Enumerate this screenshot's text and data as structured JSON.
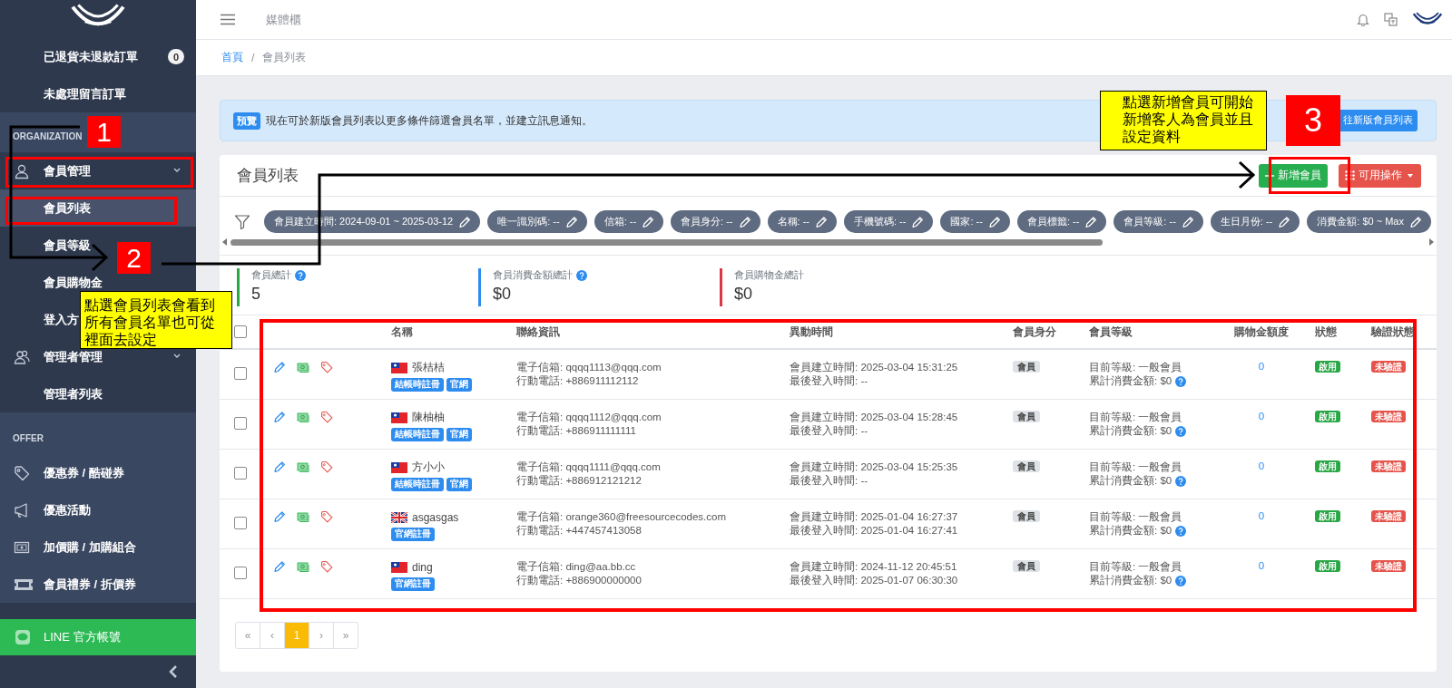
{
  "sidebar": {
    "sections": [
      {
        "items": [
          {
            "label": "已退貨未退款訂單",
            "badge": "0",
            "selected": false
          },
          {
            "label": "未處理留言訂單",
            "selected": false
          }
        ]
      },
      {
        "title": "ORGANIZATION",
        "items": [
          {
            "label": "會員管理",
            "expanded": true,
            "selected": false,
            "children": [
              {
                "label": "會員列表",
                "selected": true
              },
              {
                "label": "會員等級",
                "selected": false
              },
              {
                "label": "會員購物金",
                "selected": false
              },
              {
                "label": "登入方",
                "selected": false
              }
            ]
          },
          {
            "label": "管理者管理",
            "expanded": true,
            "selected": false,
            "children": [
              {
                "label": "管理者列表",
                "selected": false
              }
            ]
          }
        ]
      },
      {
        "title": "OFFER",
        "items": [
          {
            "label": "優惠券 / 酷碰券",
            "selected": false
          },
          {
            "label": "優惠活動",
            "selected": false
          },
          {
            "label": "加價購 / 加購組合",
            "selected": false
          },
          {
            "label": "會員禮券 / 折價券",
            "selected": false
          }
        ]
      }
    ],
    "line_button": {
      "label": "LINE 官方帳號"
    }
  },
  "topbar": {
    "title": "媒體櫃"
  },
  "breadcrumb": {
    "separator": "/",
    "items": [
      {
        "label": "首頁",
        "current": false
      },
      {
        "label": "會員列表",
        "current": true
      }
    ]
  },
  "banner": {
    "badge": "預覽",
    "text": "現在可於新版會員列表以更多條件篩選會員名單，並建立訊息通知。",
    "button": "往新版會員列表"
  },
  "card": {
    "title": "會員列表",
    "buttons": [
      {
        "label": "新增會員",
        "kind": "add"
      },
      {
        "label": "可用操作",
        "kind": "menu"
      }
    ],
    "filters": [
      "會員建立時間: 2024-09-01 ~ 2025-03-12",
      "唯一識別碼: --",
      "信箱: --",
      "會員身分: --",
      "名稱: --",
      "手機號碼: --",
      "國家: --",
      "會員標籤: --",
      "會員等級: --",
      "生日月份: --",
      "消費金額: $0 ~ Max"
    ],
    "stats": [
      {
        "label": "會員總計",
        "help": true,
        "value": "5",
        "color": "#28a745"
      },
      {
        "label": "會員消費金額總計",
        "help": true,
        "value": "$0",
        "color": "#2d8cf0"
      },
      {
        "label": "會員購物金總計",
        "help": false,
        "value": "$0",
        "color": "#dc3545"
      }
    ],
    "table": {
      "select_all": {
        "checked": false
      },
      "columns": [
        "名稱",
        "聯絡資訊",
        "異動時間",
        "會員身分",
        "會員等級",
        "購物金額度",
        "狀態",
        "驗證狀態"
      ],
      "rows": [
        {
          "checked": false,
          "kind": "tw",
          "name": "張桔桔",
          "tags": [
            "結帳時註冊",
            "官網"
          ],
          "email": "電子信箱: qqqq1113@qqq.com",
          "phone": "行動電話: +886911112112",
          "created": "會員建立時間: 2025-03-04 15:31:25",
          "last_login": "最後登入時間: --",
          "role": "會員",
          "level": "目前等級: 一般會員",
          "spent": "累計消費金額: $0",
          "credit": "0",
          "status": "啟用",
          "verification": "未驗證"
        },
        {
          "checked": false,
          "kind": "tw",
          "name": "陳柚柚",
          "tags": [
            "結帳時註冊",
            "官網"
          ],
          "email": "電子信箱: qqqq1112@qqq.com",
          "phone": "行動電話: +886911111111",
          "created": "會員建立時間: 2025-03-04 15:28:45",
          "last_login": "最後登入時間: --",
          "role": "會員",
          "level": "目前等級: 一般會員",
          "spent": "累計消費金額: $0",
          "credit": "0",
          "status": "啟用",
          "verification": "未驗證"
        },
        {
          "checked": false,
          "kind": "tw",
          "name": "方小小",
          "tags": [
            "結帳時註冊",
            "官網"
          ],
          "email": "電子信箱: qqqq1111@qqq.com",
          "phone": "行動電話: +886912121212",
          "created": "會員建立時間: 2025-03-04 15:25:35",
          "last_login": "最後登入時間: --",
          "role": "會員",
          "level": "目前等級: 一般會員",
          "spent": "累計消費金額: $0",
          "credit": "0",
          "status": "啟用",
          "verification": "未驗證"
        },
        {
          "checked": false,
          "kind": "gb",
          "name": "asgasgas",
          "tags": [
            "官網註冊"
          ],
          "email": "電子信箱: orange360@freesourcecodes.com",
          "phone": "行動電話: +447457413058",
          "created": "會員建立時間: 2025-01-04 16:27:37",
          "last_login": "最後登入時間: 2025-01-04 16:27:41",
          "role": "會員",
          "level": "目前等級: 一般會員",
          "spent": "累計消費金額: $0",
          "credit": "0",
          "status": "啟用",
          "verification": "未驗證"
        },
        {
          "checked": false,
          "kind": "tw",
          "name": "ding",
          "tags": [
            "官網註冊"
          ],
          "email": "電子信箱: ding@aa.bb.cc",
          "phone": "行動電話: +886900000000",
          "created": "會員建立時間: 2024-11-12 20:45:51",
          "last_login": "最後登入時間: 2025-01-07 06:30:30",
          "role": "會員",
          "level": "目前等級: 一般會員",
          "spent": "累計消費金額: $0",
          "credit": "0",
          "status": "啟用",
          "verification": "未驗證"
        }
      ]
    },
    "pagination": [
      {
        "label": "«",
        "selected": false
      },
      {
        "label": "‹",
        "selected": false
      },
      {
        "label": "1",
        "selected": true
      },
      {
        "label": "›",
        "selected": false
      },
      {
        "label": "»",
        "selected": false
      }
    ]
  },
  "annotations": {
    "markers": [
      "1",
      "2",
      "3"
    ],
    "callouts": [
      "點選會員列表會看到所有會員名單也可從裡面去設定",
      "點選新增會員可開始新增客人為會員並且設定資料"
    ]
  }
}
